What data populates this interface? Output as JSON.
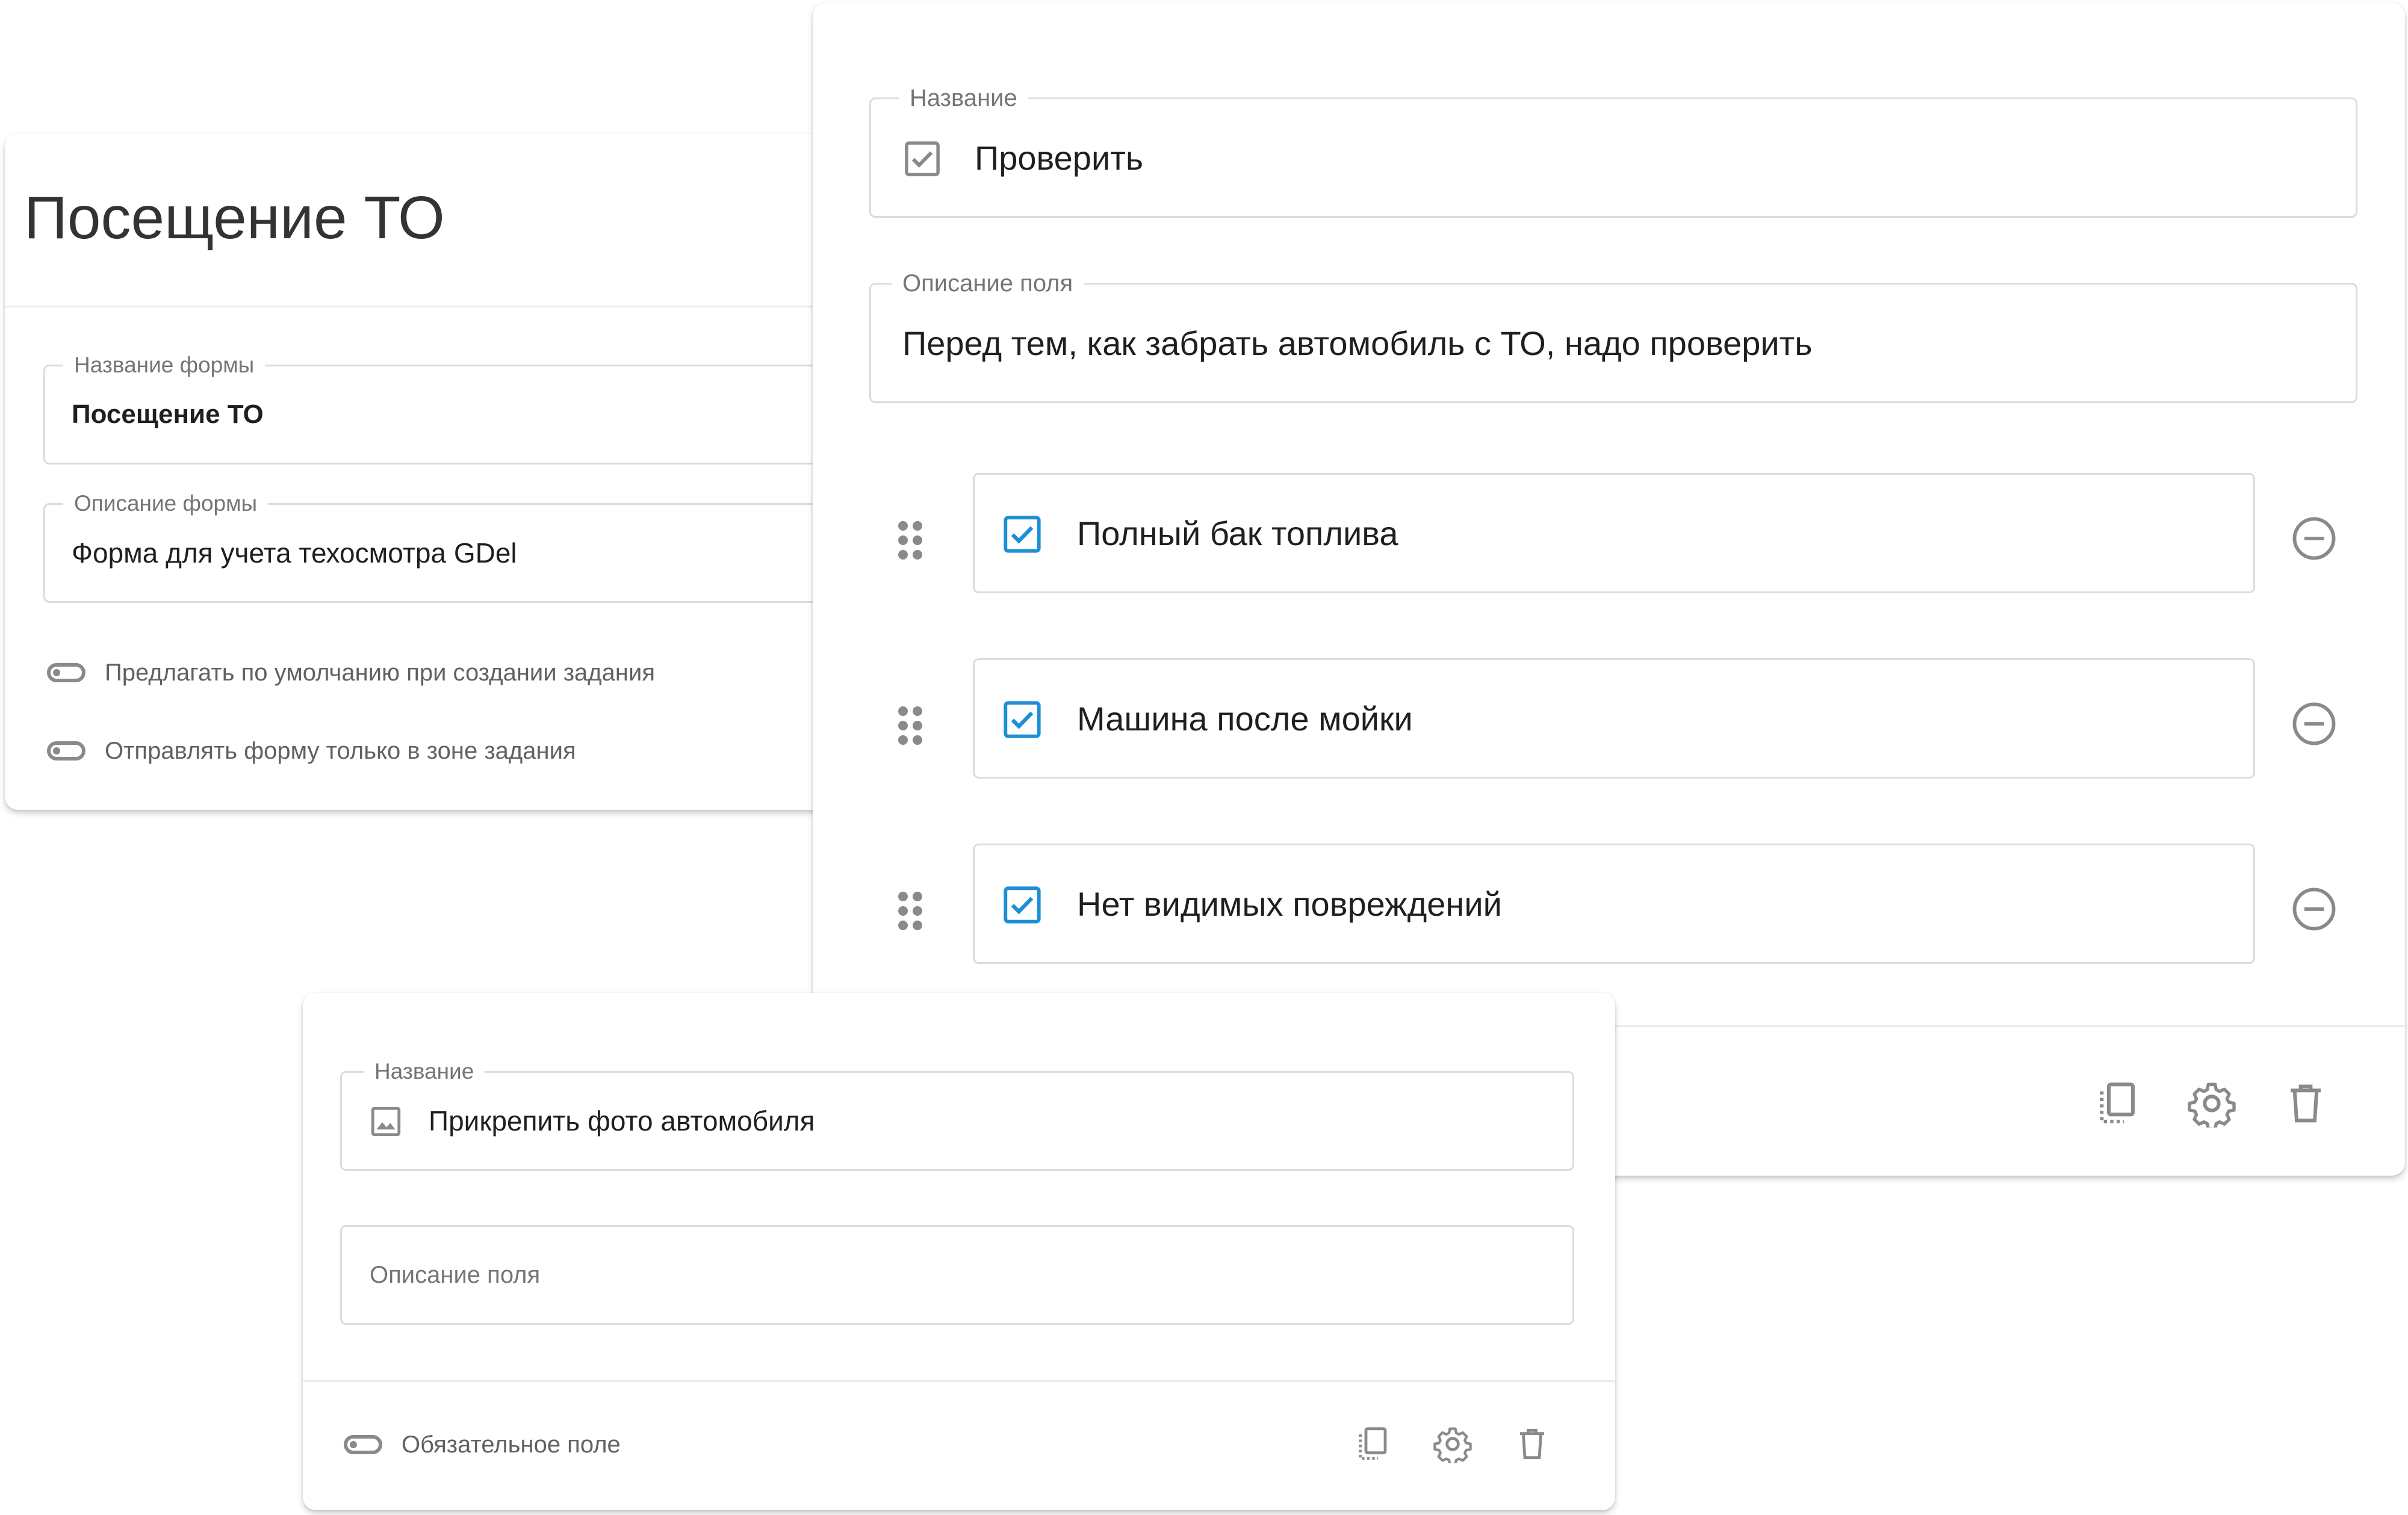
{
  "form_card": {
    "title": "Посещение ТО",
    "name_field": {
      "label": "Название формы",
      "value": "Посещение ТО"
    },
    "description_field": {
      "label": "Описание формы",
      "value": "Форма для учета техосмотра GDel"
    },
    "toggles": [
      {
        "label": "Предлагать по умолчанию при создании задания"
      },
      {
        "label": "Отправлять форму только в зоне задания"
      }
    ]
  },
  "checklist_card": {
    "name_field": {
      "label": "Название",
      "value": "Проверить",
      "icon": "checkbox-icon"
    },
    "description_field": {
      "label": "Описание поля",
      "value": "Перед тем, как забрать автомобиль с ТО, надо проверить"
    },
    "options": [
      {
        "label": "Полный бак топлива",
        "checked": true
      },
      {
        "label": "Машина после мойки",
        "checked": true
      },
      {
        "label": "Нет видимых повреждений",
        "checked": true
      }
    ],
    "footer_icons": [
      "copy-icon",
      "gear-icon",
      "trash-icon"
    ]
  },
  "photo_card": {
    "name_field": {
      "label": "Название",
      "value": "Прикрепить фото автомобиля",
      "icon": "image-icon"
    },
    "description_field": {
      "placeholder": "Описание поля"
    },
    "required_toggle": {
      "label": "Обязательное поле"
    },
    "footer_icons": [
      "copy-icon",
      "gear-icon",
      "trash-icon"
    ]
  },
  "colors": {
    "accent": "#1e8fd6",
    "icon_gray": "#8a8a8a",
    "border": "#dcdcdc",
    "label_gray": "#757575"
  }
}
